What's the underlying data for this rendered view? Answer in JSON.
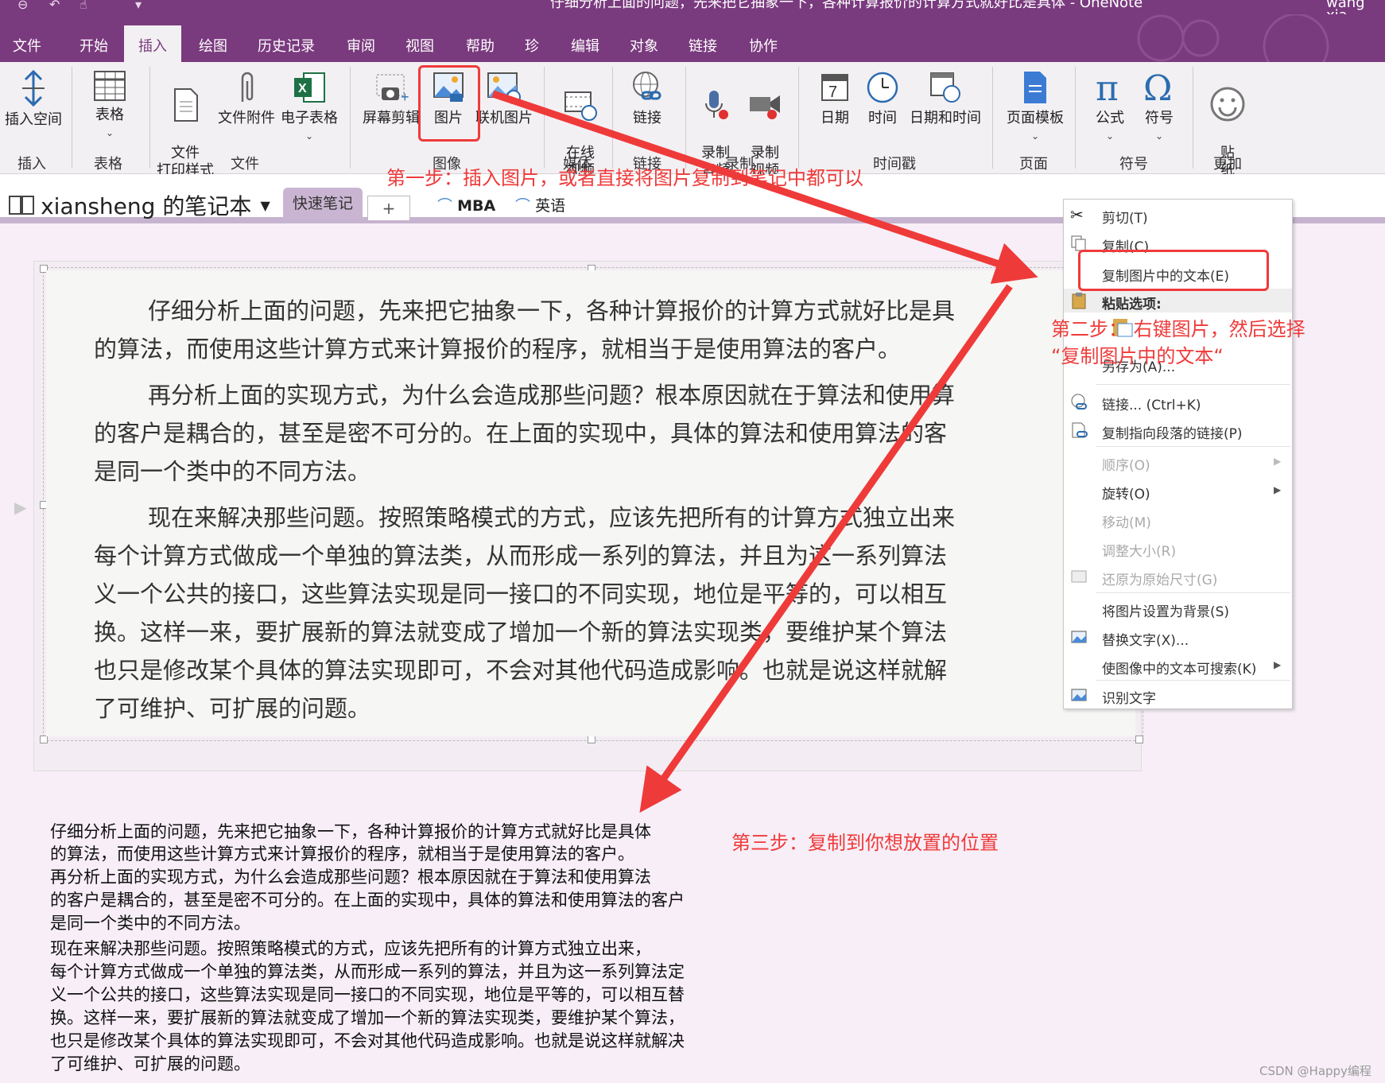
{
  "window": {
    "title": "仔细分析上面的问题，先来把它抽象一下，各种计算报价的计算方式就好比是具体  -  OneNote",
    "user": "wang xia"
  },
  "menu_tabs": [
    "文件",
    "开始",
    "插入",
    "绘图",
    "历史记录",
    "审阅",
    "视图",
    "帮助",
    "珍",
    "编辑",
    "对象",
    "链接",
    "协作"
  ],
  "ribbon": {
    "buttons": {
      "insert_space": "插入空间",
      "table": "表格",
      "file_printout": "文件\n打印样式",
      "file_attachment": "文件附件",
      "spreadsheet": "电子表格",
      "screen_clipping": "屏幕剪辑",
      "picture": "图片",
      "online_picture": "联机图片",
      "online_video": "在线\n视频",
      "link": "链接",
      "record_audio": "录制\n音频",
      "record_video": "录制\n视频",
      "date": "日期",
      "time": "时间",
      "date_time": "日期和时间",
      "page_template": "页面模板",
      "equation": "公式",
      "symbol": "符号",
      "sticker": "贴\n纸"
    },
    "groups": {
      "insert": "插入",
      "tables": "表格",
      "files": "文件",
      "images": "图像",
      "media": "媒体",
      "links": "链接",
      "recording": "录制",
      "timestamp": "时间戳",
      "pages": "页面",
      "symbols": "符号",
      "more": "更加"
    }
  },
  "notebook": {
    "name": "xiansheng 的笔记本",
    "section": "快速笔记",
    "add": "+",
    "links": [
      "MBA",
      "英语"
    ]
  },
  "scanned_image_lines": [
    "仔细分析上面的问题，先来把它抽象一下，各种计算报价的计算方式就好比是具",
    "的算法，而使用这些计算方式来计算报价的程序，就相当于是使用算法的客户。",
    "再分析上面的实现方式，为什么会造成那些问题？根本原因就在于算法和使用算",
    "的客户是耦合的，甚至是密不可分的。在上面的实现中，具体的算法和使用算法的客",
    "是同一个类中的不同方法。",
    "现在来解决那些问题。按照策略模式的方式，应该先把所有的计算方式独立出来",
    "每个计算方式做成一个单独的算法类，从而形成一系列的算法，并且为这一系列算法",
    "义一个公共的接口，这些算法实现是同一接口的不同实现，地位是平等的，可以相互",
    "换。这样一来，要扩展新的算法就变成了增加一个新的算法实现类，要维护某个算法",
    "也只是修改某个具体的算法实现即可，不会对其他代码造成影响。也就是说这样就解",
    "了可维护、可扩展的问题。"
  ],
  "pasted_text_lines": [
    "仔细分析上面的问题，先来把它抽象一下，各种计算报价的计算方式就好比是具体",
    "的算法，而使用这些计算方式来计算报价的程序，就相当于是使用算法的客户。",
    "再分析上面的实现方式，为什么会造成那些问题？根本原因就在于算法和使用算法",
    "的客户是耦合的，甚至是密不可分的。在上面的实现中，具体的算法和使用算法的客户",
    "是同一个类中的不同方法。",
    "现在来解决那些问题。按照策略模式的方式，应该先把所有的计算方式独立出来，",
    "每个计算方式做成一个单独的算法类，从而形成一系列的算法，并且为这一系列算法定",
    "义一个公共的接口，这些算法实现是同一接口的不同实现，地位是平等的，可以相互替",
    "换。这样一来，要扩展新的算法就变成了增加一个新的算法实现类，要维护某个算法，",
    "也只是修改某个具体的算法实现即可，不会对其他代码造成影响。也就是说这样就解决",
    "了可维护、可扩展的问题。"
  ],
  "context_menu": {
    "cut": "剪切(T)",
    "copy": "复制(C)",
    "copy_text_from_picture": "复制图片中的文本(E)",
    "paste_options": "粘贴选项:",
    "save_as": "另存为(A)...",
    "link": "链接...  (Ctrl+K)",
    "copy_link_paragraph": "复制指向段落的链接(P)",
    "order": "顺序(O)",
    "rotate": "旋转(O)",
    "move": "移动(M)",
    "resize": "调整大小(R)",
    "restore_size": "还原为原始尺寸(G)",
    "set_background": "将图片设置为背景(S)",
    "alt_text": "替换文字(X)...",
    "make_searchable": "使图像中的文本可搜索(K)",
    "recognize_text": "识别文字"
  },
  "annotations": {
    "step1": "第一步：插入图片，或者直接将图片复制到笔记中都可以",
    "step2a": "第二步：   右键图片，然后选择",
    "step2b": "“复制图片中的文本“",
    "step3": "第三步：复制到你想放置的位置"
  },
  "watermark": "CSDN @Happy编程",
  "colors": {
    "brand": "#7a3a7e",
    "annotation": "#ef3a3a"
  }
}
